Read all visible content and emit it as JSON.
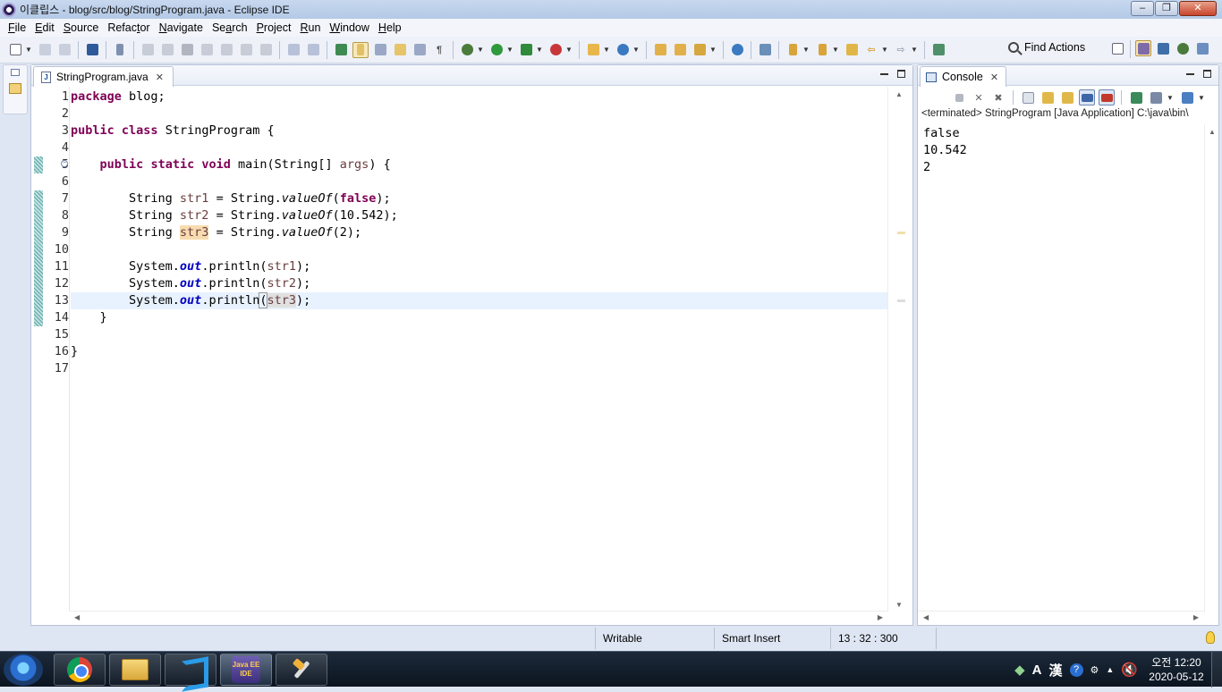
{
  "window": {
    "title": "이클립스 - blog/src/blog/StringProgram.java - Eclipse IDE",
    "minimize": "–",
    "maximize": "❐",
    "close": "✕"
  },
  "menu": [
    {
      "label": "File",
      "u": "F",
      "rest": "ile"
    },
    {
      "label": "Edit",
      "u": "E",
      "rest": "dit"
    },
    {
      "label": "Source",
      "u": "S",
      "rest": "ource"
    },
    {
      "label": "Refactor",
      "pre": "Refac",
      "u": "t",
      "rest": "or"
    },
    {
      "label": "Navigate",
      "u": "N",
      "rest": "avigate"
    },
    {
      "label": "Search",
      "pre": "Se",
      "u": "a",
      "rest": "rch"
    },
    {
      "label": "Project",
      "u": "P",
      "rest": "roject"
    },
    {
      "label": "Run",
      "u": "R",
      "rest": "un"
    },
    {
      "label": "Window",
      "u": "W",
      "rest": "indow"
    },
    {
      "label": "Help",
      "u": "H",
      "rest": "elp"
    }
  ],
  "toolbar": {
    "find_actions": "Find Actions"
  },
  "editor": {
    "tab_label": "StringProgram.java",
    "tab_close": "✕",
    "line_numbers": [
      "1",
      "2",
      "3",
      "4",
      "5",
      "6",
      "7",
      "8",
      "9",
      "10",
      "11",
      "12",
      "13",
      "14",
      "15",
      "16",
      "17"
    ]
  },
  "console": {
    "tab_label": "Console",
    "tab_close": "✕",
    "terminated_line": "<terminated> StringProgram [Java Application] C:\\java\\bin\\",
    "output": [
      "false",
      "10.542",
      "2"
    ]
  },
  "status": {
    "writable": "Writable",
    "insert_mode": "Smart Insert",
    "position": "13 : 32 : 300"
  },
  "taskbar": {
    "eclipse_label": "Java EE IDE",
    "clock_time": "오전 12:20",
    "clock_date": "2020-05-12",
    "ime_a": "A",
    "ime_han": "漢"
  },
  "colors": {
    "keyword": "#7f0055",
    "local_var": "#6a3e3e",
    "field": "#0000c0",
    "current_line": "#e8f2fe",
    "occurrence_highlight": "#f8dcb0"
  }
}
